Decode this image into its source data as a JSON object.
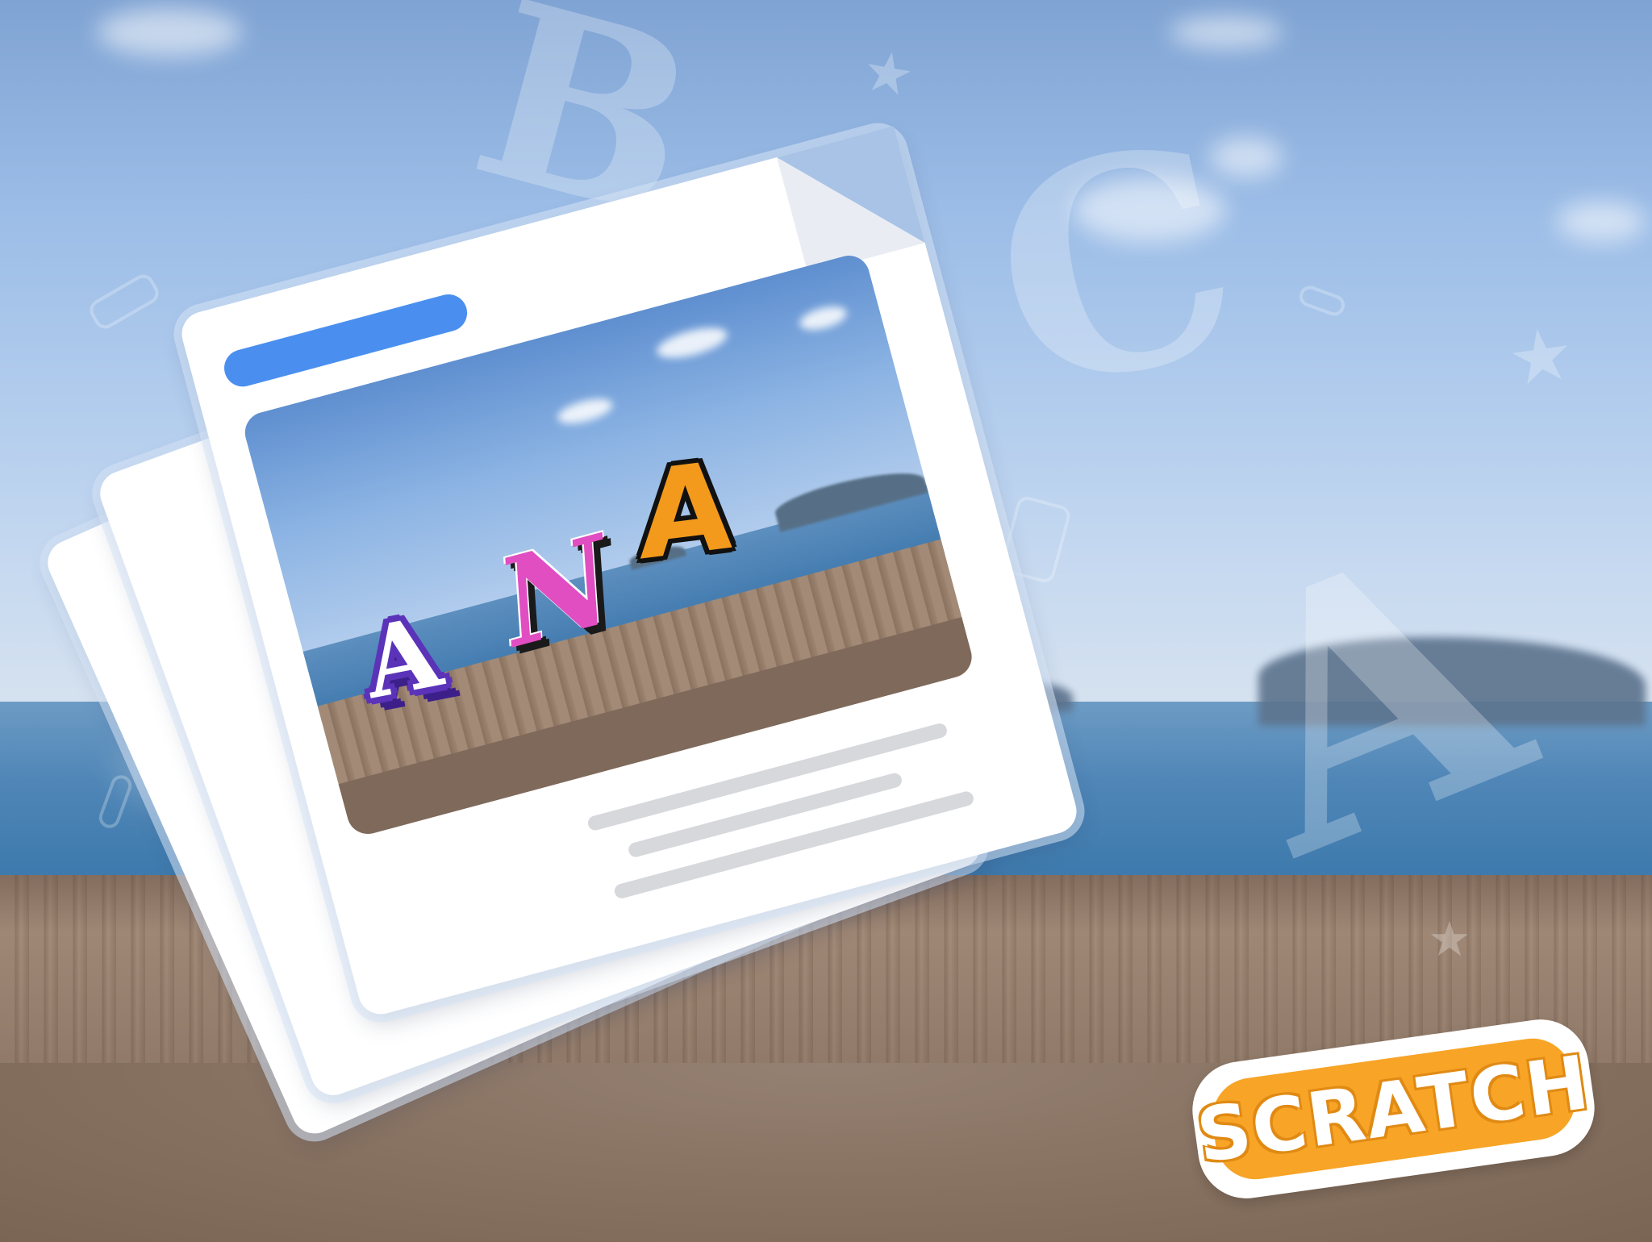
{
  "photo": {
    "letters": [
      "A",
      "N",
      "A"
    ]
  },
  "logo": {
    "text": "SCRATCH"
  },
  "colors": {
    "title_bar": "#4a8ff0",
    "letter_a1_fill": "#ffffff",
    "letter_a1_outline": "#5b33b8",
    "letter_n": "#e04ec2",
    "letter_a2": "#f39a1c",
    "logo_orange": "#f7a427"
  }
}
